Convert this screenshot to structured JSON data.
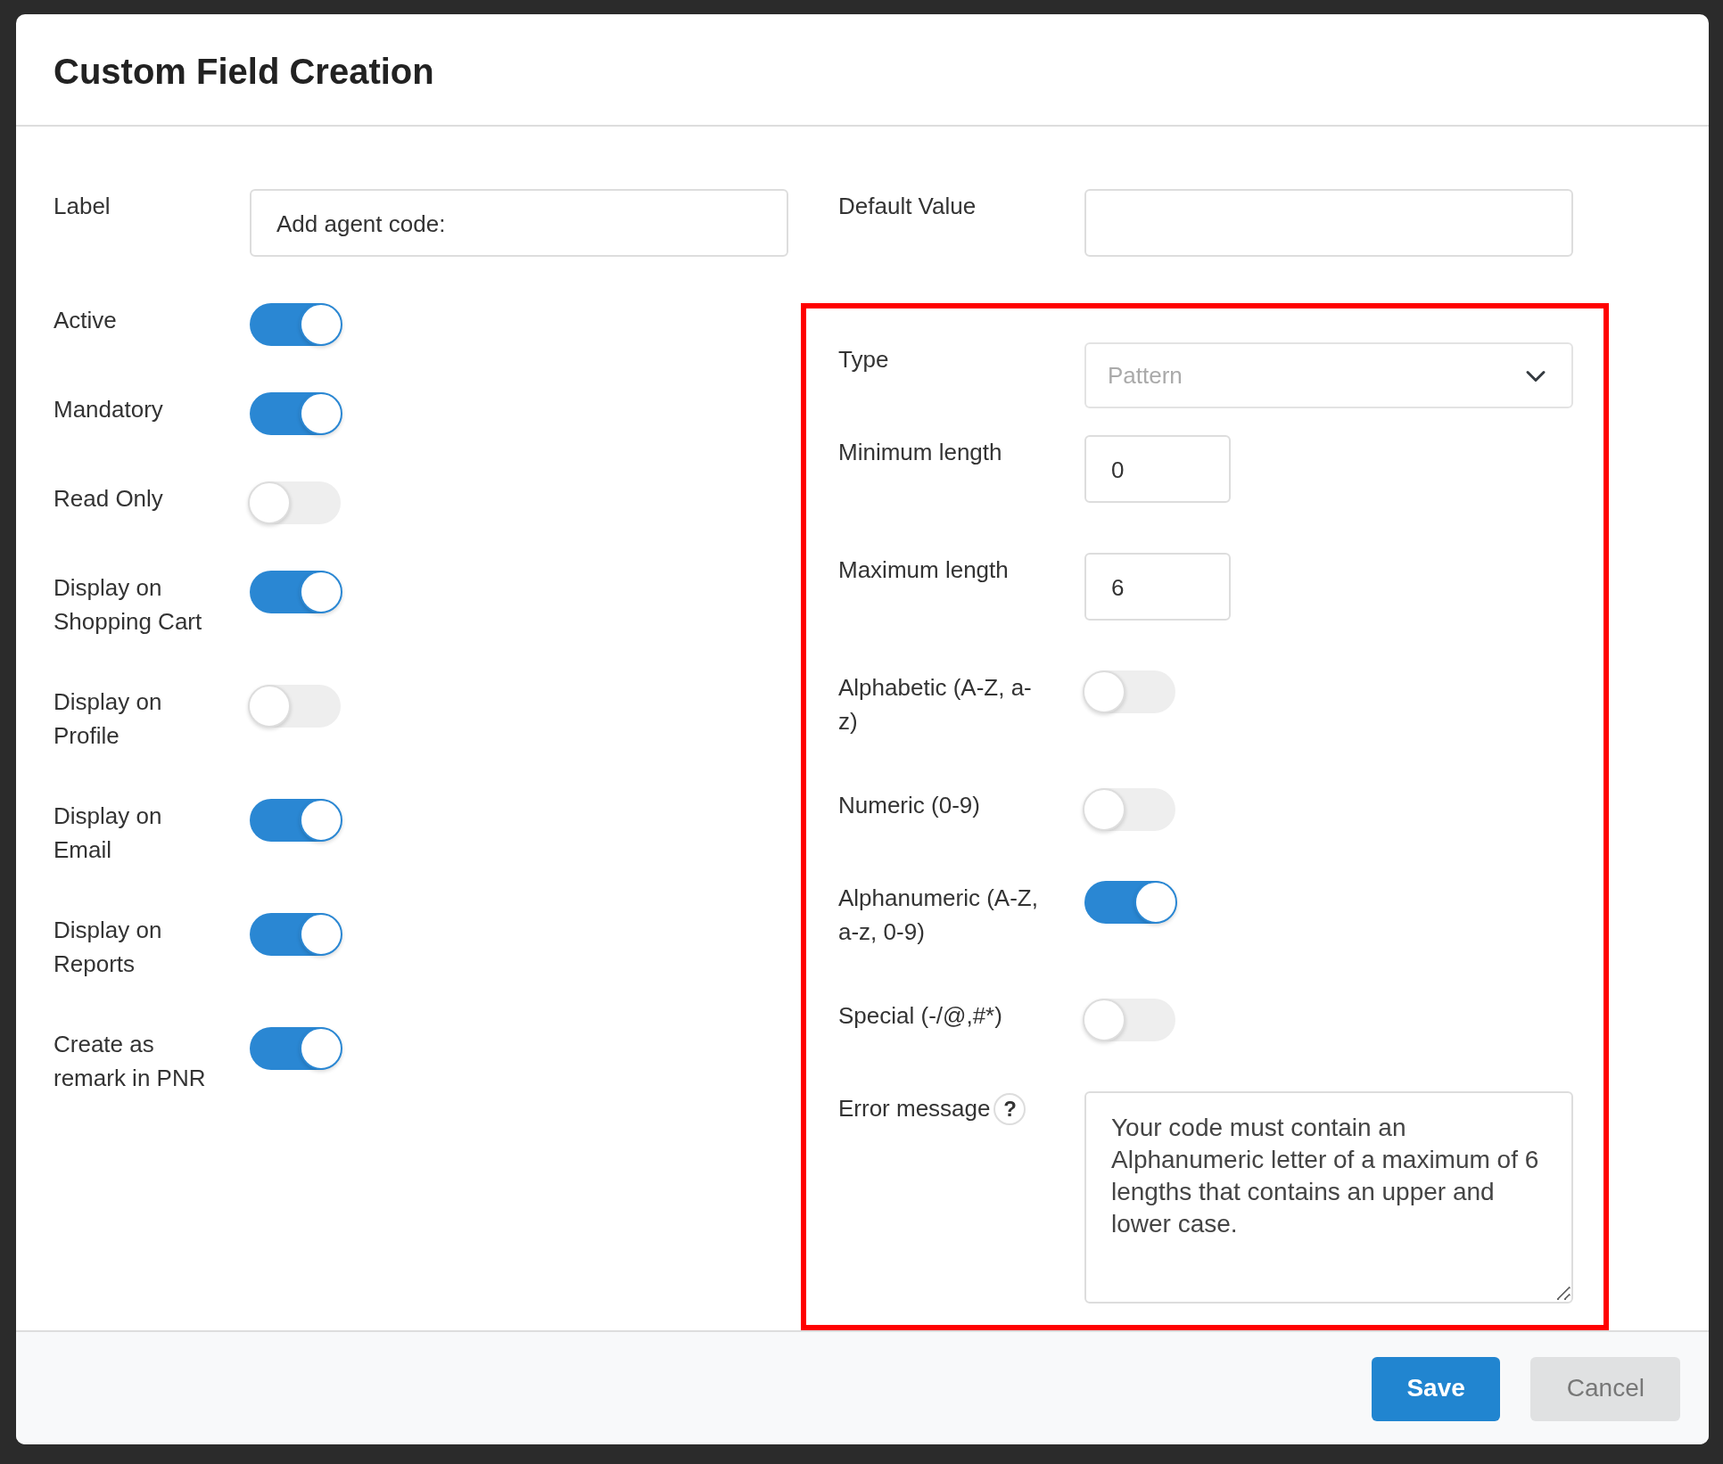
{
  "dialog": {
    "title": "Custom Field Creation"
  },
  "left_fields": [
    {
      "kind": "text",
      "label": "Label",
      "value": "Add agent code:"
    },
    {
      "kind": "toggle",
      "label": "Active",
      "on": true
    },
    {
      "kind": "toggle",
      "label": "Mandatory",
      "on": true
    },
    {
      "kind": "toggle",
      "label": "Read Only",
      "on": false
    },
    {
      "kind": "toggle",
      "label": "Display on Shopping Cart",
      "on": true
    },
    {
      "kind": "toggle",
      "label": "Display on Profile",
      "on": false
    },
    {
      "kind": "toggle",
      "label": "Display on Email",
      "on": true
    },
    {
      "kind": "toggle",
      "label": "Display on Reports",
      "on": true
    },
    {
      "kind": "toggle",
      "label": "Create as remark in PNR",
      "on": true
    }
  ],
  "right_fields": [
    {
      "kind": "text",
      "label": "Default Value"
    }
  ],
  "pattern_section": {
    "highlighted": true,
    "fields": [
      {
        "kind": "select",
        "label": "Type",
        "value": "Pattern",
        "disabled": true
      },
      {
        "kind": "short_text",
        "label": "Minimum length",
        "value": "0"
      },
      {
        "kind": "short_text",
        "label": "Maximum length",
        "value": "6"
      },
      {
        "kind": "toggle",
        "label": "Alphabetic (A-Z, a-z)",
        "on": false
      },
      {
        "kind": "toggle",
        "label": "Numeric (0-9)",
        "on": false
      },
      {
        "kind": "toggle",
        "label": "Alphanumeric (A-Z, a-z, 0-9)",
        "on": true
      },
      {
        "kind": "toggle",
        "label": "Special (-/@,#*)",
        "on": false
      },
      {
        "kind": "textarea",
        "label": "Error message",
        "help": "?",
        "value": "Your code must contain an Alphanumeric letter of a maximum of 6 lengths that contains an upper and lower case."
      }
    ]
  },
  "buttons": [
    {
      "kind": "primary",
      "label": "Save"
    },
    {
      "kind": "secondary",
      "label": "Cancel"
    }
  ]
}
